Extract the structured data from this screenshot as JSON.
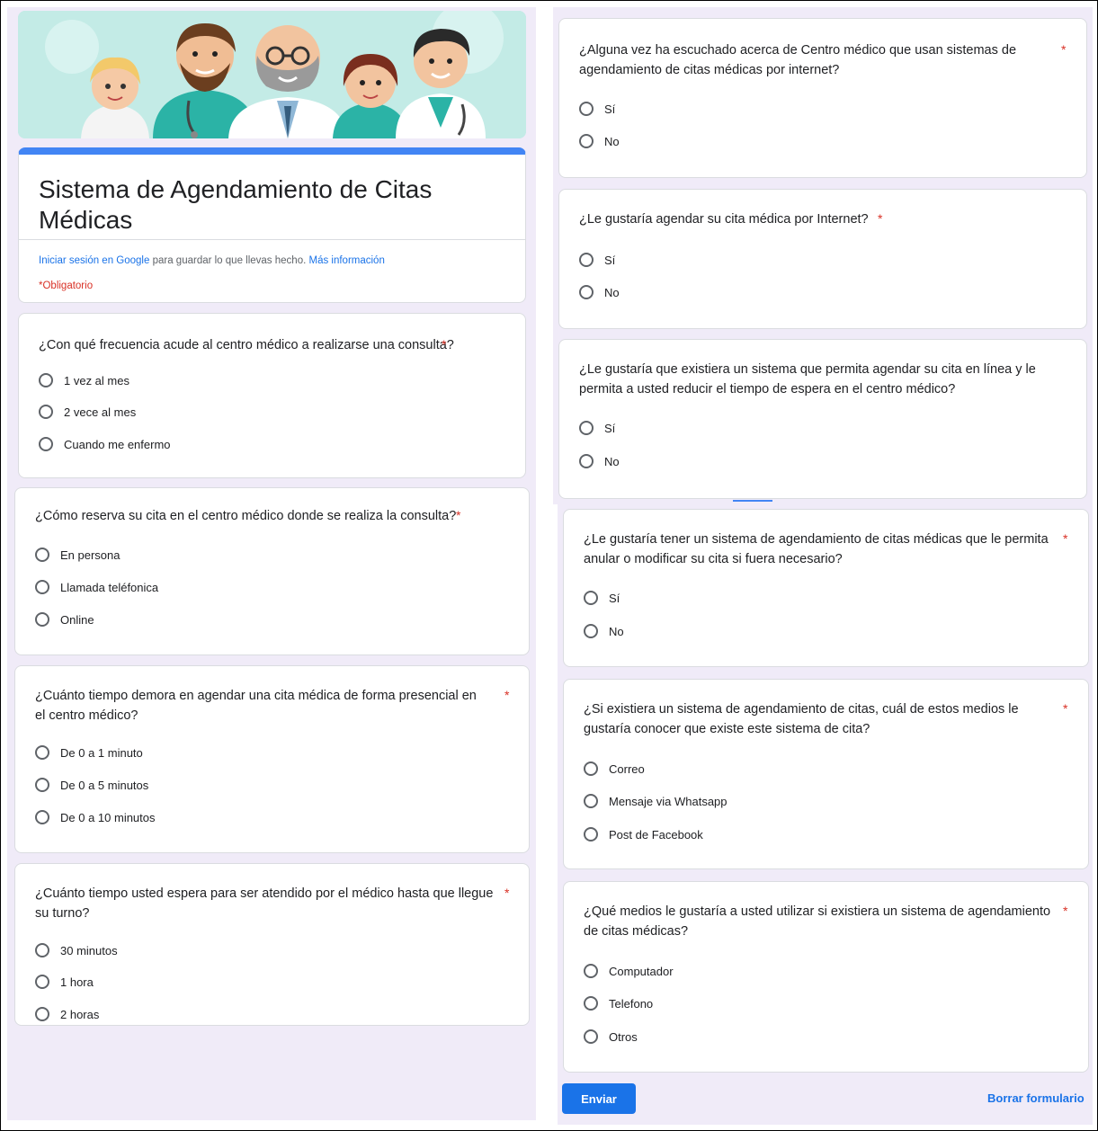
{
  "form": {
    "title": "Sistema de Agendamiento de Citas Médicas",
    "signin_link": "Iniciar sesión en Google",
    "signin_text": " para guardar lo que llevas hecho. ",
    "more_info_link": "Más información",
    "required_note": "*Obligatorio"
  },
  "questions": [
    {
      "title": "¿Con qué frecuencia acude al centro médico a realizarse una consulta?",
      "required": "*",
      "options": [
        "1 vez al mes",
        "2 vece al mes",
        "Cuando me enfermo"
      ]
    },
    {
      "title": "¿Cómo reserva su cita en el centro médico donde se realiza la consulta?",
      "required": "*",
      "options": [
        "En persona",
        "Llamada teléfonica",
        "Online"
      ]
    },
    {
      "title": "¿Cuánto tiempo demora en agendar una cita médica de forma presencial en el centro médico?",
      "required": "*",
      "options": [
        "De 0 a 1 minuto",
        "De 0 a 5 minutos",
        "De 0 a 10 minutos"
      ]
    },
    {
      "title": "¿Cuánto tiempo usted espera para ser atendido por el médico hasta que llegue su turno?",
      "required": "*",
      "options": [
        "30 minutos",
        "1 hora",
        "2 horas"
      ]
    },
    {
      "title": "¿Alguna vez ha escuchado acerca de Centro médico que usan sistemas de agendamiento de citas médicas por internet?",
      "required": "*",
      "options": [
        "Sí",
        "No"
      ]
    },
    {
      "title": "¿Le gustaría agendar su cita médica por Internet?",
      "required": "*",
      "options": [
        "Sí",
        "No"
      ]
    },
    {
      "title": "¿Le gustaría que existiera un sistema que permita agendar su cita en línea y le permita a usted reducir el tiempo de espera en el centro médico?",
      "required": "",
      "options": [
        "Sí",
        "No"
      ]
    },
    {
      "title": "¿Le gustaría tener un sistema de agendamiento de citas médicas que le permita anular o modificar su cita si fuera necesario?",
      "required": "*",
      "options": [
        "Sí",
        "No"
      ]
    },
    {
      "title": "¿Si existiera un sistema de agendamiento de citas, cuál de estos medios le gustaría conocer que existe este sistema de cita?",
      "required": "*",
      "options": [
        "Correo",
        "Mensaje via Whatsapp",
        "Post de Facebook"
      ]
    },
    {
      "title": "¿Qué medios le gustaría a usted utilizar si existiera un sistema de agendamiento de citas médicas?",
      "required": "*",
      "options": [
        "Computador",
        "Telefono",
        "Otros"
      ]
    }
  ],
  "actions": {
    "submit": "Enviar",
    "clear": "Borrar formulario"
  },
  "colors": {
    "accent": "#4285f4",
    "button": "#1a73e8",
    "required": "#d93025",
    "background": "#f0ebf8"
  },
  "header_image": "doctors-banner-illustration"
}
